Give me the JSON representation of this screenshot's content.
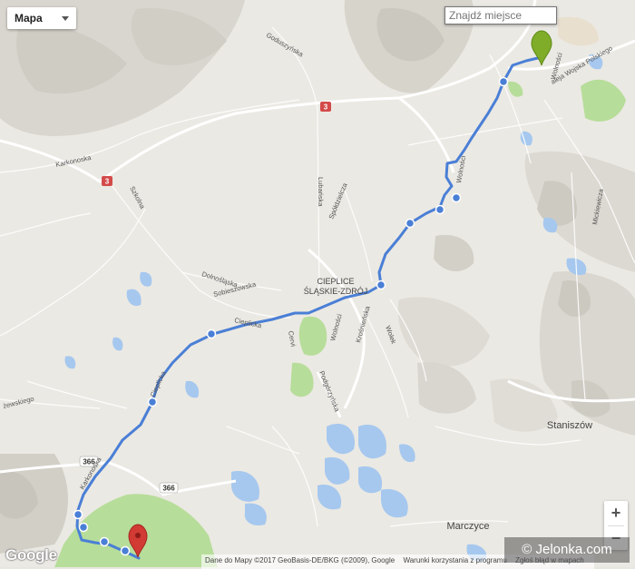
{
  "controls": {
    "map_type": "Mapa",
    "search_placeholder": "Znajdź miejsce",
    "zoom_in": "+",
    "zoom_out": "−"
  },
  "labels": {
    "goduszynska": "Goduszyńska",
    "karkonoska": "Karkonoska",
    "szkolna": "Szkolna",
    "lubanska": "Lubańska",
    "spoldzielcza": "Spółdzielcza",
    "dolnoslaska": "Dolnośląska",
    "sobieszowska": "Sobieszowska",
    "cieplice_line1": "CIEPLICE",
    "cieplice_line2": "ŚLĄSKIE-ZDRÓJ",
    "cieplicka": "Cieplicka",
    "wolnosci": "Wolności",
    "krosnienska": "Krośnieńska",
    "wolek": "Wolek",
    "cervi": "Cervi",
    "podgorzynska": "Podgórzyńska",
    "wojska_polskiego": "aleja Wojska Polskiego",
    "mickiewicza": "Mickiewicza",
    "wolnosci_upper": "Wolności",
    "ceglane": "żewskiego",
    "staniszow": "Staniszów",
    "marczyce": "Marczyce",
    "road3_a": "3",
    "road3_b": "3",
    "road366_a": "366",
    "road366_b": "366",
    "road366_c": "366"
  },
  "attribution": {
    "data": "Dane do Mapy ©2017 GeoBasis-DE/BKG (©2009), Google",
    "terms": "Warunki korzystania z programu",
    "report": "Zgłoś błąd w mapach"
  },
  "google_logo": "Google",
  "watermark": "© Jelonka.com",
  "colors": {
    "route": "#4a7fd6",
    "waypoint": "#4a7fd6",
    "start_marker": "#7fad2a",
    "end_marker": "#d23a34",
    "water": "#a6c8ef",
    "park": "#b7dd9a",
    "road_badge": "#d44a4a"
  }
}
